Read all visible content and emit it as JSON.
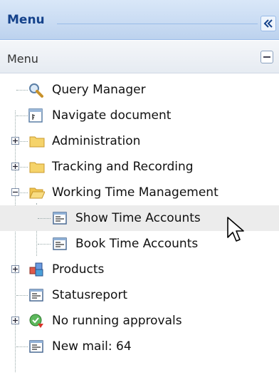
{
  "panel": {
    "title": "Menu"
  },
  "section": {
    "title": "Menu"
  },
  "tree": [
    {
      "label": "Query Manager",
      "icon": "magnifier-icon"
    },
    {
      "label": "Navigate document",
      "icon": "document-icon"
    },
    {
      "label": "Administration",
      "icon": "folder-icon"
    },
    {
      "label": "Tracking and Recording",
      "icon": "folder-icon"
    },
    {
      "label": "Working Time Management",
      "icon": "folder-open-icon"
    },
    {
      "label": "Show Time Accounts",
      "icon": "list-icon"
    },
    {
      "label": "Book Time Accounts",
      "icon": "list-icon"
    },
    {
      "label": "Products",
      "icon": "cubes-icon"
    },
    {
      "label": "Statusreport",
      "icon": "list-icon"
    },
    {
      "label": "No running approvals",
      "icon": "approval-icon"
    },
    {
      "label": "New mail: 64",
      "icon": "list-icon"
    }
  ],
  "colors": {
    "header": "#cadcf3",
    "header_text": "#15428b",
    "folder": "#f5d36a",
    "selected_row": "#ececec"
  }
}
